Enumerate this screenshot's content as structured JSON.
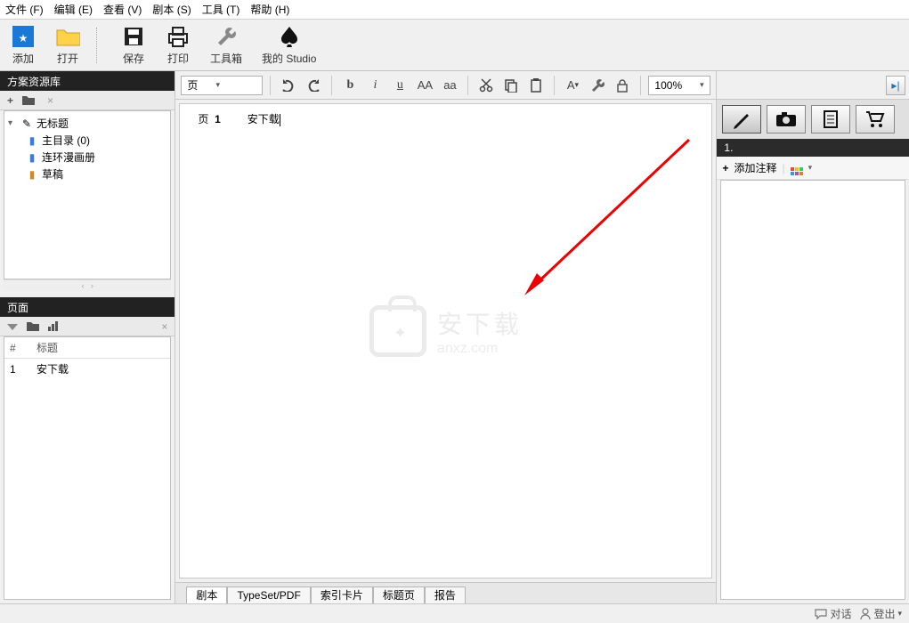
{
  "menu": {
    "file": "文件 (F)",
    "edit": "编辑 (E)",
    "view": "查看 (V)",
    "script": "剧本 (S)",
    "tools": "工具 (T)",
    "help": "帮助 (H)"
  },
  "toolbar": {
    "add": "添加",
    "open": "打开",
    "save": "保存",
    "print": "打印",
    "toolbox": "工具箱",
    "studio": "我的 Studio"
  },
  "left": {
    "resources_title": "方案资源库",
    "tree": {
      "root": "无标题",
      "main_index": "主目录 (0)",
      "comic_book": "连环漫画册",
      "draft": "草稿"
    },
    "pages_title": "页面",
    "pages_table": {
      "col_num": "#",
      "col_title": "标题",
      "rows": [
        {
          "num": "1",
          "title": "安下载"
        }
      ]
    }
  },
  "editor": {
    "style_combo": "页",
    "zoom": "100%",
    "page_label": "页",
    "page_num": "1",
    "page_text": "安下载"
  },
  "watermark": {
    "cn": "安下载",
    "en": "anxz.com"
  },
  "tabs": {
    "script": "剧本",
    "typeset": "TypeSet/PDF",
    "index_card": "索引卡片",
    "title_page": "标题页",
    "report": "报告"
  },
  "right": {
    "section_num": "1.",
    "add_note": "添加注释"
  },
  "status": {
    "chat": "对话",
    "logout": "登出"
  }
}
